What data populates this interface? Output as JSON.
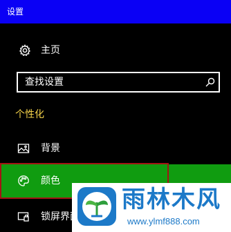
{
  "window": {
    "title": "设置"
  },
  "home": {
    "label": "主页",
    "icon": "gear-icon"
  },
  "search": {
    "placeholder": "查找设置",
    "icon": "search-icon"
  },
  "section": {
    "title": "个性化"
  },
  "nav": {
    "items": [
      {
        "label": "背景",
        "icon": "picture-icon"
      },
      {
        "label": "颜色",
        "icon": "palette-icon",
        "selected": true
      },
      {
        "label": "锁屏界面",
        "icon": "lockscreen-icon"
      }
    ]
  },
  "watermark": {
    "title": "雨林木风",
    "url": "www.ylmf888.com"
  },
  "colors": {
    "titlebar": "#0a00f5",
    "background": "#000000",
    "accent_selected": "#109c10",
    "selection_border": "#a31414",
    "section_title": "#f5d34a",
    "watermark_text": "#1c79c8"
  }
}
